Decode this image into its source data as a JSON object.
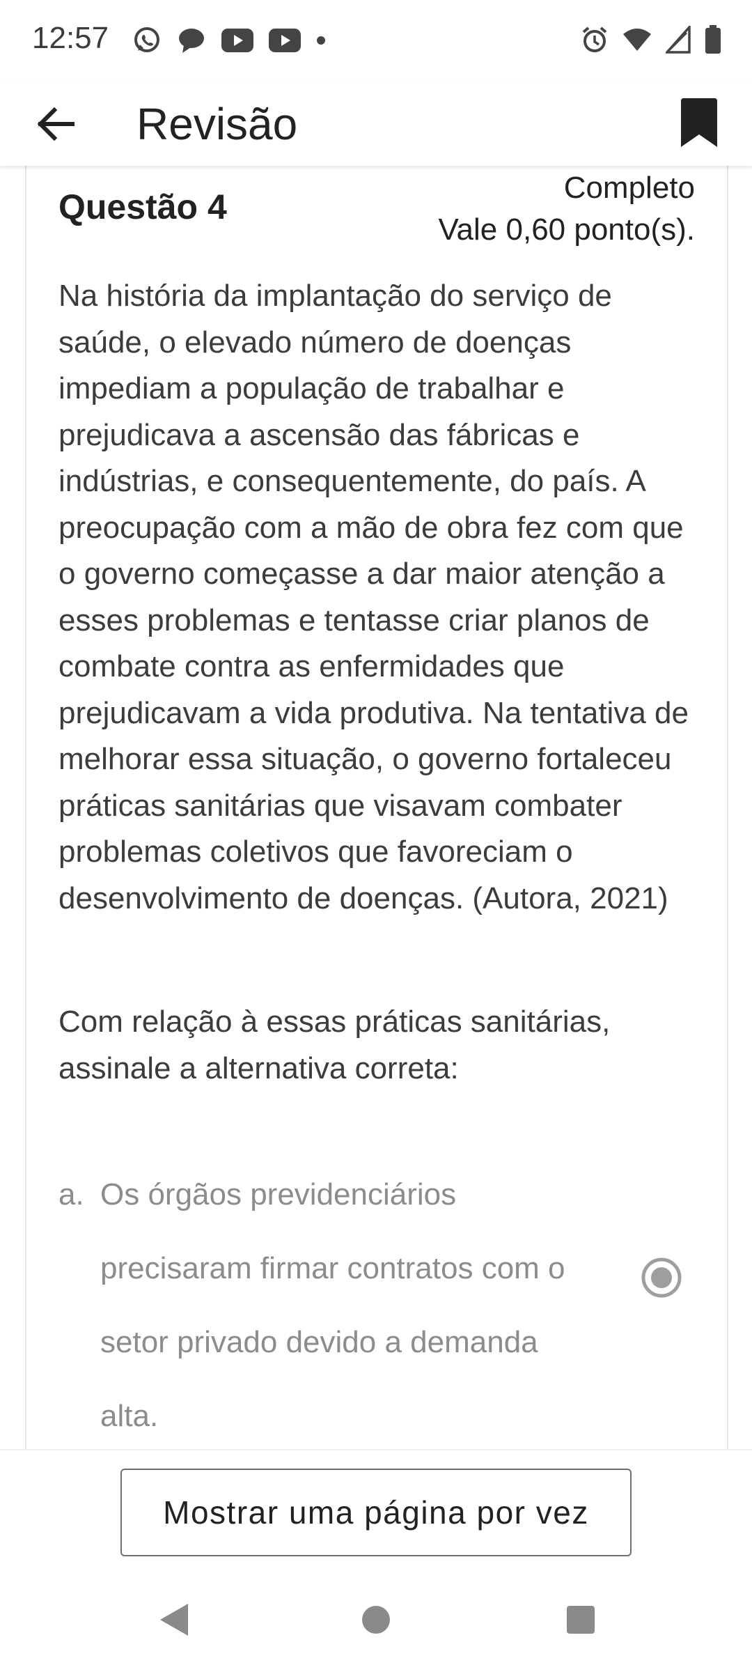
{
  "status_bar": {
    "time": "12:57",
    "left_icons": [
      "whatsapp-icon",
      "chat-bubble-icon",
      "youtube-icon",
      "youtube-icon",
      "dot-icon"
    ],
    "right_icons": [
      "alarm-icon",
      "wifi-icon",
      "signal-icon",
      "battery-icon"
    ]
  },
  "app_bar": {
    "back_icon": "arrow-left-icon",
    "title": "Revisão",
    "bookmark_icon": "bookmark-icon"
  },
  "question": {
    "title": "Questão 4",
    "status": "Completo",
    "points": "Vale 0,60 ponto(s).",
    "text": "Na história da implantação do serviço de saúde, o elevado número de doenças impediam a população de trabalhar e prejudicava a ascensão das fábricas e indústrias, e consequentemente, do país. A preocupação com a mão de obra fez com que o governo começasse a dar maior atenção a esses problemas e tentasse criar planos de combate contra as enfermidades que prejudicavam a vida produtiva. Na tentativa de melhorar essa situação, o governo fortaleceu práticas sanitárias que visavam combater problemas coletivos que favoreciam o desenvolvimento de doenças. (Autora, 2021)",
    "prompt": "Com relação à essas práticas sanitárias, assinale a alternativa correta:",
    "options": [
      {
        "letter": "a.",
        "text": "Os órgãos previdenciários precisaram firmar contratos com o setor privado devido a demanda alta.",
        "selected": true
      }
    ]
  },
  "bottom": {
    "page_mode_button": "Mostrar uma página por vez"
  },
  "colors": {
    "text_primary": "#222222",
    "text_body": "#3c3c3c",
    "text_option": "#8c8c8c",
    "radio": "#9e9e9e"
  }
}
